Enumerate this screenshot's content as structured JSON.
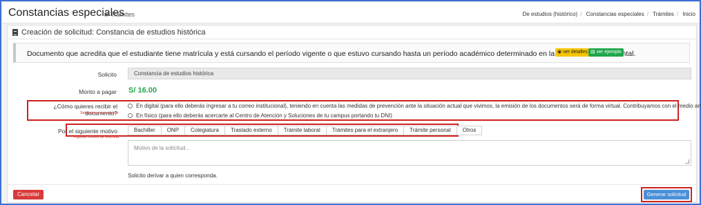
{
  "header": {
    "title": "Constancias especiales",
    "subtitle": "Trámites",
    "breadcrumb": [
      "De estudios (histórico)",
      "Constancias especiales",
      "Trámites",
      "Inicio"
    ]
  },
  "panel": {
    "title": "Creación de solicitud: Constancia de estudios histórica",
    "info_text": "Documento que acredita que el estudiante tiene matrícula y está cursando el período vigente o que estuvo cursando hasta un período académico determinado en la Universidad Continental.",
    "details_button": "ver detalles",
    "example_button": "ver ejemplo"
  },
  "form": {
    "solicito_label": "Solicito",
    "solicito_value": "Constancia de estudios histórica",
    "amount_label": "Monto a pagar",
    "amount_value": "S/ 16.00",
    "delivery_label": "¿Cómo quieres recibir el documento?",
    "delivery_hint": "Selecciona una opción",
    "delivery_options": [
      "En digital (para ello deberás ingresar a tu correo institucional), teniendo en cuenta las medidas de prevención ante la situación actual que vivimos, la emisión de los documentos será de forma virtual. Contribuyamos con el medio ambiente.",
      "En físico (para ello deberás acercarte al Centro de Atención y Soluciones de tu campus portando tu DNI)"
    ],
    "motive_label": "Por el siguiente motivo",
    "motive_hint": "Ingrese motivo de solicitud",
    "motives": [
      "Bachiller",
      "ONP",
      "Colegiatura",
      "Traslado externo",
      "Trámite laboral",
      "Trámites para el extranjero",
      "Trámite personal",
      "Otros"
    ],
    "motive_placeholder": "Motivo de la solicitud...",
    "derive_text": "Solicito derivar a quien corresponda."
  },
  "actions": {
    "cancel": "Cancelar",
    "submit": "Generar solicitud"
  },
  "colors": {
    "frame": "#3b6fd6",
    "amount": "#1fa64a",
    "highlight": "#d01f1f",
    "cancel": "#d93a3a",
    "submit": "#4a8fd9",
    "details": "#f6c500",
    "example": "#1fa64a"
  },
  "icons": {
    "title": "folder-icon",
    "panel": "document-icon",
    "details": "eye-icon",
    "example": "file-icon"
  }
}
